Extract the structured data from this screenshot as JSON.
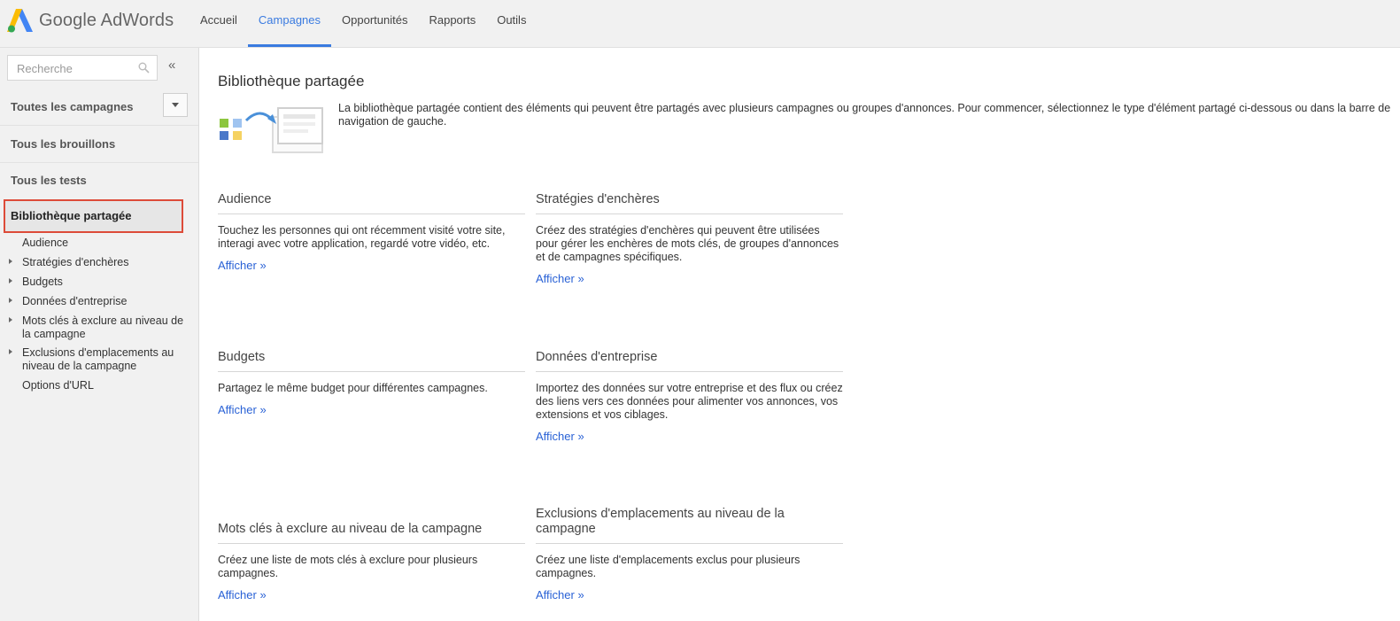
{
  "header": {
    "logo_text": "Google AdWords",
    "nav": [
      {
        "label": "Accueil",
        "active": false
      },
      {
        "label": "Campagnes",
        "active": true
      },
      {
        "label": "Opportunités",
        "active": false
      },
      {
        "label": "Rapports",
        "active": false
      },
      {
        "label": "Outils",
        "active": false
      }
    ],
    "accent_color": "#3a7be0"
  },
  "sidebar": {
    "search_placeholder": "Recherche",
    "collapse_symbol": "«",
    "all_campaigns": "Toutes les campagnes",
    "all_drafts": "Tous les brouillons",
    "all_tests": "Tous les tests",
    "shared_library": "Bibliothèque partagée",
    "highlight_color": "#dd4b39",
    "sub_items": [
      {
        "label": "Audience",
        "expandable": false
      },
      {
        "label": "Stratégies d'enchères",
        "expandable": true
      },
      {
        "label": "Budgets",
        "expandable": true
      },
      {
        "label": "Données d'entreprise",
        "expandable": true
      },
      {
        "label": "Mots clés à exclure au niveau de la campagne",
        "expandable": true
      },
      {
        "label": "Exclusions d'emplacements au niveau de la campagne",
        "expandable": true
      },
      {
        "label": "Options d'URL",
        "expandable": false
      }
    ]
  },
  "main": {
    "title": "Bibliothèque partagée",
    "intro": "La bibliothèque partagée contient des éléments qui peuvent être partagés avec plusieurs campagnes ou groupes d'annonces. Pour commencer, sélectionnez le type d'élément partagé ci-dessous ou dans la barre de navigation de gauche.",
    "link_color": "#2a62d6",
    "cards": [
      {
        "title": "Audience",
        "desc": "Touchez les personnes qui ont récemment visité votre site, interagi avec votre application, regardé votre vidéo, etc.",
        "link": "Afficher »"
      },
      {
        "title": "Stratégies d'enchères",
        "desc": "Créez des stratégies d'enchères qui peuvent être utilisées pour gérer les enchères de mots clés, de groupes d'annonces et de campagnes spécifiques.",
        "link": "Afficher »"
      },
      {
        "title": "Budgets",
        "desc": "Partagez le même budget pour différentes campagnes.",
        "link": "Afficher »"
      },
      {
        "title": "Données d'entreprise",
        "desc": "Importez des données sur votre entreprise et des flux ou créez des liens vers ces données pour alimenter vos annonces, vos extensions et vos ciblages.",
        "link": "Afficher »"
      },
      {
        "title": "Mots clés à exclure au niveau de la campagne",
        "desc": "Créez une liste de mots clés à exclure pour plusieurs campagnes.",
        "link": "Afficher »"
      },
      {
        "title": "Exclusions d'emplacements au niveau de la campagne",
        "desc": "Créez une liste d'emplacements exclus pour plusieurs campagnes.",
        "link": "Afficher »"
      }
    ]
  }
}
